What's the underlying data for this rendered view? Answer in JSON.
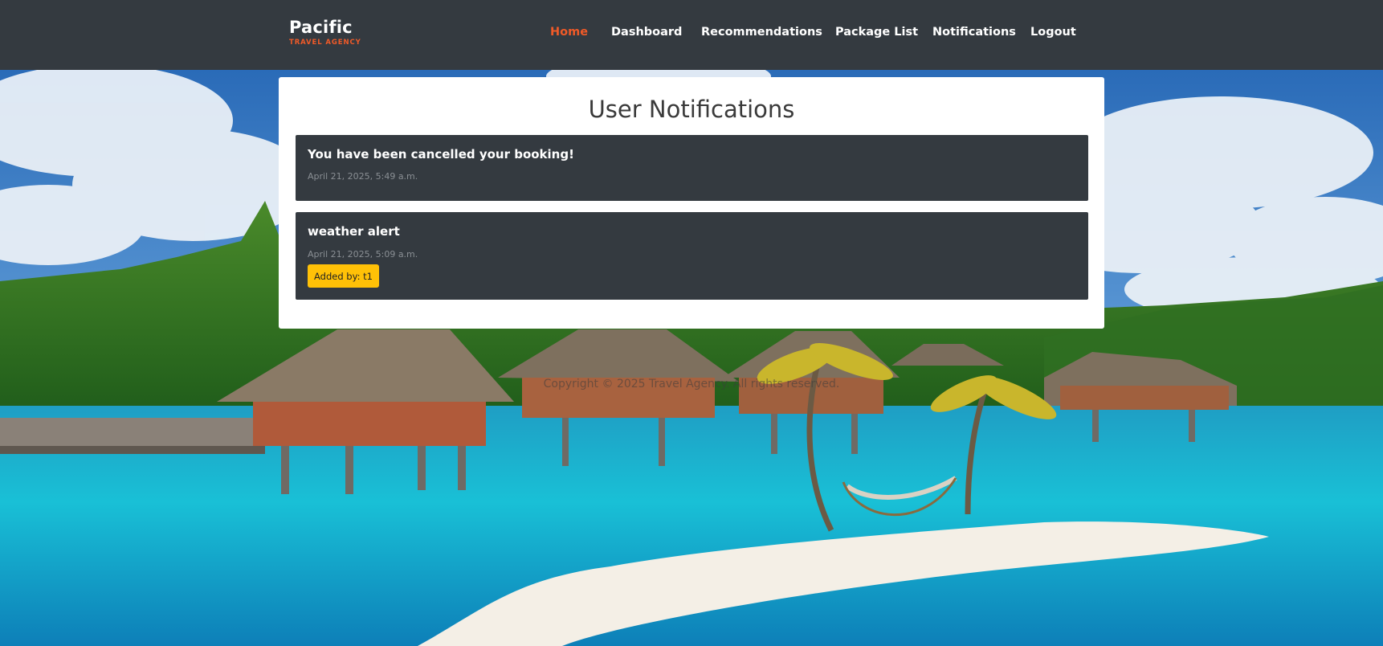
{
  "brand": {
    "name": "Pacific",
    "subtitle": "TRAVEL AGENCY"
  },
  "nav": {
    "items": [
      {
        "label": "Home",
        "active": true
      },
      {
        "label": "Dashboard",
        "active": false
      },
      {
        "label": "Recommendations",
        "active": false
      },
      {
        "label": "Package List",
        "active": false
      },
      {
        "label": "Notifications",
        "active": false
      },
      {
        "label": "Logout",
        "active": false
      }
    ]
  },
  "page": {
    "title": "User Notifications"
  },
  "notifications": [
    {
      "title": "You have been cancelled your booking!",
      "time": "April 21, 2025, 5:49 a.m."
    },
    {
      "title": "weather alert",
      "time": "April 21, 2025, 5:09 a.m.",
      "badge": "Added by: t1"
    }
  ],
  "footer": {
    "text": "Copyright © 2025 Travel Agency. All rights reserved."
  },
  "colors": {
    "navbar": "#343a40",
    "accent": "#f05a28",
    "card": "#ffffff",
    "notification_bg": "#343a40",
    "badge": "#ffc107"
  }
}
